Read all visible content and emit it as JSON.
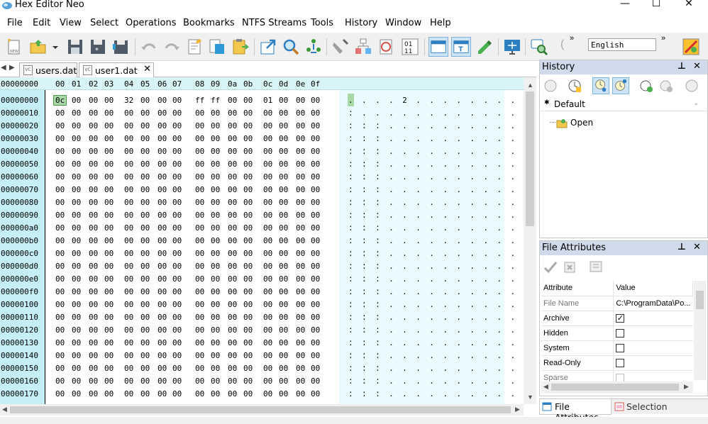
{
  "window": {
    "title": "Hex Editor Neo",
    "min": "—",
    "max": "☐",
    "close": "✕"
  },
  "menu": [
    "File",
    "Edit",
    "View",
    "Select",
    "Operations",
    "Bookmarks",
    "NTFS Streams",
    "Tools",
    "History",
    "Window",
    "Help"
  ],
  "toolbar": {
    "language": "English",
    "overflow": "»"
  },
  "tabs": [
    {
      "label": "users.dat",
      "icon_text": "VC"
    },
    {
      "label": "user1.dat",
      "icon_text": "VC"
    }
  ],
  "tab_close": "✕",
  "nav_arrows": {
    "left": "◀",
    "right": "▶"
  },
  "hex": {
    "header_addr": "00000000",
    "columns": [
      "00",
      "01",
      "02",
      "03",
      "04",
      "05",
      "06",
      "07",
      "08",
      "09",
      "0a",
      "0b",
      "0c",
      "0d",
      "0e",
      "0f"
    ],
    "rows": [
      {
        "addr": "00000000",
        "bytes": [
          "0c",
          "00",
          "00",
          "00",
          "32",
          "00",
          "00",
          "00",
          "ff",
          "ff",
          "00",
          "00",
          "01",
          "00",
          "00",
          "00"
        ],
        "ascii": ". . . . 2 . . .     . . . . . ."
      },
      {
        "addr": "00000010",
        "bytes": [
          "00",
          "00",
          "00",
          "00",
          "00",
          "00",
          "00",
          "00",
          "00",
          "00",
          "00",
          "00",
          "00",
          "00",
          "00",
          "00"
        ],
        "ascii": ". . . . . . . . . . . . . . . ."
      },
      {
        "addr": "00000020",
        "bytes": [
          "00",
          "00",
          "00",
          "00",
          "00",
          "00",
          "00",
          "00",
          "00",
          "00",
          "00",
          "00",
          "00",
          "00",
          "00",
          "00"
        ],
        "ascii": ". . . . . . . . . . . . . . . ."
      },
      {
        "addr": "00000030",
        "bytes": [
          "00",
          "00",
          "00",
          "00",
          "00",
          "00",
          "00",
          "00",
          "00",
          "00",
          "00",
          "00",
          "00",
          "00",
          "00",
          "00"
        ],
        "ascii": ". . . . . . . . . . . . . . . ."
      },
      {
        "addr": "00000040",
        "bytes": [
          "00",
          "00",
          "00",
          "00",
          "00",
          "00",
          "00",
          "00",
          "00",
          "00",
          "00",
          "00",
          "00",
          "00",
          "00",
          "00"
        ],
        "ascii": ". . . . . . . . . . . . . . . ."
      },
      {
        "addr": "00000050",
        "bytes": [
          "00",
          "00",
          "00",
          "00",
          "00",
          "00",
          "00",
          "00",
          "00",
          "00",
          "00",
          "00",
          "00",
          "00",
          "00",
          "00"
        ],
        "ascii": ". . . . . . . . . . . . . . . ."
      },
      {
        "addr": "00000060",
        "bytes": [
          "00",
          "00",
          "00",
          "00",
          "00",
          "00",
          "00",
          "00",
          "00",
          "00",
          "00",
          "00",
          "00",
          "00",
          "00",
          "00"
        ],
        "ascii": ". . . . . . . . . . . . . . . ."
      },
      {
        "addr": "00000070",
        "bytes": [
          "00",
          "00",
          "00",
          "00",
          "00",
          "00",
          "00",
          "00",
          "00",
          "00",
          "00",
          "00",
          "00",
          "00",
          "00",
          "00"
        ],
        "ascii": ". . . . . . . . . . . . . . . ."
      },
      {
        "addr": "00000080",
        "bytes": [
          "00",
          "00",
          "00",
          "00",
          "00",
          "00",
          "00",
          "00",
          "00",
          "00",
          "00",
          "00",
          "00",
          "00",
          "00",
          "00"
        ],
        "ascii": ". . . . . . . . . . . . . . . ."
      },
      {
        "addr": "00000090",
        "bytes": [
          "00",
          "00",
          "00",
          "00",
          "00",
          "00",
          "00",
          "00",
          "00",
          "00",
          "00",
          "00",
          "00",
          "00",
          "00",
          "00"
        ],
        "ascii": ". . . . . . . . . . . . . . . ."
      },
      {
        "addr": "000000a0",
        "bytes": [
          "00",
          "00",
          "00",
          "00",
          "00",
          "00",
          "00",
          "00",
          "00",
          "00",
          "00",
          "00",
          "00",
          "00",
          "00",
          "00"
        ],
        "ascii": ". . . . . . . . . . . . . . . ."
      },
      {
        "addr": "000000b0",
        "bytes": [
          "00",
          "00",
          "00",
          "00",
          "00",
          "00",
          "00",
          "00",
          "00",
          "00",
          "00",
          "00",
          "00",
          "00",
          "00",
          "00"
        ],
        "ascii": ". . . . . . . . . . . . . . . ."
      },
      {
        "addr": "000000c0",
        "bytes": [
          "00",
          "00",
          "00",
          "00",
          "00",
          "00",
          "00",
          "00",
          "00",
          "00",
          "00",
          "00",
          "00",
          "00",
          "00",
          "00"
        ],
        "ascii": ". . . . . . . . . . . . . . . ."
      },
      {
        "addr": "000000d0",
        "bytes": [
          "00",
          "00",
          "00",
          "00",
          "00",
          "00",
          "00",
          "00",
          "00",
          "00",
          "00",
          "00",
          "00",
          "00",
          "00",
          "00"
        ],
        "ascii": ". . . . . . . . . . . . . . . ."
      },
      {
        "addr": "000000e0",
        "bytes": [
          "00",
          "00",
          "00",
          "00",
          "00",
          "00",
          "00",
          "00",
          "00",
          "00",
          "00",
          "00",
          "00",
          "00",
          "00",
          "00"
        ],
        "ascii": ". . . . . . . . . . . . . . . ."
      },
      {
        "addr": "000000f0",
        "bytes": [
          "00",
          "00",
          "00",
          "00",
          "00",
          "00",
          "00",
          "00",
          "00",
          "00",
          "00",
          "00",
          "00",
          "00",
          "00",
          "00"
        ],
        "ascii": ". . . . . . . . . . . . . . . ."
      },
      {
        "addr": "00000100",
        "bytes": [
          "00",
          "00",
          "00",
          "00",
          "00",
          "00",
          "00",
          "00",
          "00",
          "00",
          "00",
          "00",
          "00",
          "00",
          "00",
          "00"
        ],
        "ascii": ". . . . . . . . . . . . . . . ."
      },
      {
        "addr": "00000110",
        "bytes": [
          "00",
          "00",
          "00",
          "00",
          "00",
          "00",
          "00",
          "00",
          "00",
          "00",
          "00",
          "00",
          "00",
          "00",
          "00",
          "00"
        ],
        "ascii": ". . . . . . . . . . . . . . . ."
      },
      {
        "addr": "00000120",
        "bytes": [
          "00",
          "00",
          "00",
          "00",
          "00",
          "00",
          "00",
          "00",
          "00",
          "00",
          "00",
          "00",
          "00",
          "00",
          "00",
          "00"
        ],
        "ascii": ". . . . . . . . . . . . . . . ."
      },
      {
        "addr": "00000130",
        "bytes": [
          "00",
          "00",
          "00",
          "00",
          "00",
          "00",
          "00",
          "00",
          "00",
          "00",
          "00",
          "00",
          "00",
          "00",
          "00",
          "00"
        ],
        "ascii": ". . . . . . . . . . . . . . . ."
      },
      {
        "addr": "00000140",
        "bytes": [
          "00",
          "00",
          "00",
          "00",
          "00",
          "00",
          "00",
          "00",
          "00",
          "00",
          "00",
          "00",
          "00",
          "00",
          "00",
          "00"
        ],
        "ascii": ". . . . . . . . . . . . . . . ."
      },
      {
        "addr": "00000150",
        "bytes": [
          "00",
          "00",
          "00",
          "00",
          "00",
          "00",
          "00",
          "00",
          "00",
          "00",
          "00",
          "00",
          "00",
          "00",
          "00",
          "00"
        ],
        "ascii": ". . . . . . . . . . . . . . . ."
      },
      {
        "addr": "00000160",
        "bytes": [
          "00",
          "00",
          "00",
          "00",
          "00",
          "00",
          "00",
          "00",
          "00",
          "00",
          "00",
          "00",
          "00",
          "00",
          "00",
          "00"
        ],
        "ascii": ". . . . . . . . . . . . . . . ."
      },
      {
        "addr": "00000170",
        "bytes": [
          "00",
          "00",
          "00",
          "00",
          "00",
          "00",
          "00",
          "00",
          "00",
          "00",
          "00",
          "00",
          "00",
          "00",
          "00",
          "00"
        ],
        "ascii": ". . . . . . . . . . . . . . . ."
      }
    ]
  },
  "history": {
    "title": "History",
    "pin": "⊥",
    "close": "✕",
    "group": "Default",
    "group_toggle": "✱",
    "items": [
      "Open"
    ]
  },
  "attributes": {
    "title": "File Attributes",
    "pin": "⊥",
    "close": "✕",
    "header_attr": "Attribute",
    "header_value": "Value",
    "rows": [
      {
        "name": "File Name",
        "value": "C:\\ProgramData\\Po...",
        "type": "text",
        "muted": true
      },
      {
        "name": "Archive",
        "value": "✓",
        "type": "check",
        "muted": false
      },
      {
        "name": "Hidden",
        "value": "",
        "type": "check",
        "muted": false
      },
      {
        "name": "System",
        "value": "",
        "type": "check",
        "muted": false
      },
      {
        "name": "Read-Only",
        "value": "",
        "type": "check",
        "muted": false
      },
      {
        "name": "Sparse",
        "value": "",
        "type": "check",
        "muted": true
      }
    ]
  },
  "bottom_tabs": {
    "file_attributes": "File Attributes",
    "selection": "Selection"
  },
  "colors": {
    "addr_bg": "#c5eef5",
    "header_bg": "#d9f4f7",
    "ascii_bg": "#e9fbfd",
    "selection": "#a8d8a8",
    "panel_title": "#cfdbea"
  }
}
